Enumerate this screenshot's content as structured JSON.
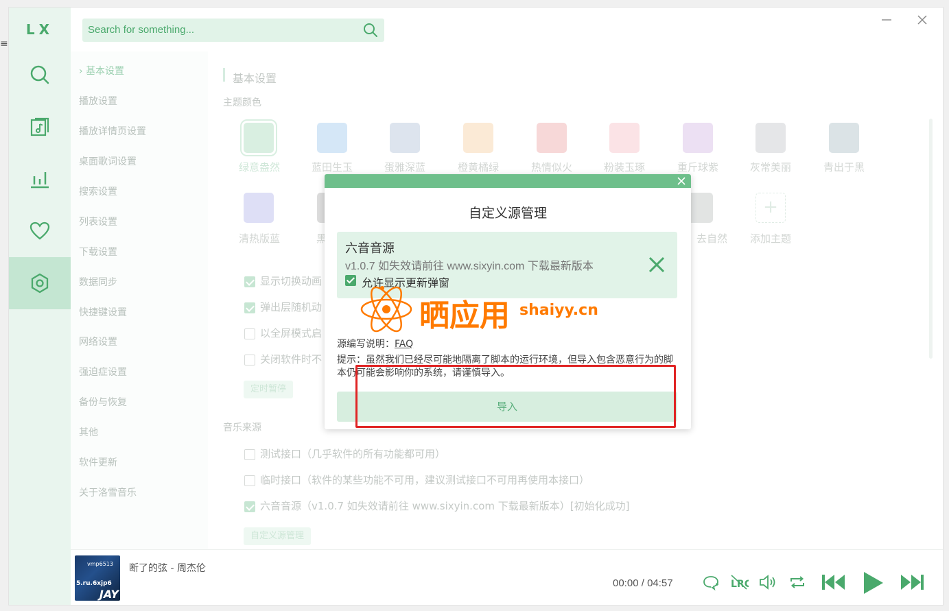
{
  "app": {
    "logo": "LX"
  },
  "colors": {
    "accent": "#4aa96c",
    "nav_bg": "#e9f5ee",
    "nav_active": "#c4e6d2",
    "modal_header": "#6ebf8b"
  },
  "outer": {
    "menu_glyph": "≡"
  },
  "nav": {
    "items": [
      {
        "icon": "search-icon"
      },
      {
        "icon": "music-list-icon"
      },
      {
        "icon": "chart-icon"
      },
      {
        "icon": "heart-icon"
      },
      {
        "icon": "settings-icon",
        "active": true
      }
    ]
  },
  "search": {
    "placeholder": "Search for something..."
  },
  "settings_nav": {
    "items": [
      "基本设置",
      "播放设置",
      "播放详情页设置",
      "桌面歌词设置",
      "搜索设置",
      "列表设置",
      "下载设置",
      "数据同步",
      "快捷键设置",
      "网络设置",
      "强迫症设置",
      "备份与恢复",
      "其他",
      "软件更新",
      "关于洛雪音乐"
    ],
    "active_index": 0
  },
  "content": {
    "section_title": "基本设置",
    "theme_label": "主题颜色",
    "themes_row1": [
      {
        "name": "绿意盎然",
        "color": "#d9efe1"
      },
      {
        "name": "蓝田生玉",
        "color": "#d5e7f7"
      },
      {
        "name": "蛋雅深蓝",
        "color": "#dde4ee"
      },
      {
        "name": "橙黄橘绿",
        "color": "#fbead6"
      },
      {
        "name": "热情似火",
        "color": "#f7d8d8"
      },
      {
        "name": "粉装玉琢",
        "color": "#fbe3e6"
      },
      {
        "name": "重斤球紫",
        "color": "#ece0f3"
      },
      {
        "name": "灰常美丽",
        "color": "#e5e6e8"
      },
      {
        "name": "青出于黑",
        "color": "#dbe3e6"
      }
    ],
    "themes_row2": [
      {
        "name": "清热版蓝",
        "color": "#dedff6"
      },
      {
        "name": "黑",
        "color": "#dcdcdc"
      },
      {
        "name": "去自然",
        "color": "#e2e4e3"
      },
      {
        "name": "添加主题",
        "color": "#ffffff"
      }
    ],
    "options": [
      {
        "label": "显示切换动画",
        "checked": true
      },
      {
        "label": "弹出层随机动",
        "checked": true
      },
      {
        "label": "以全屏模式启",
        "checked": false
      },
      {
        "label": "关闭软件时不",
        "checked": false
      }
    ],
    "timer_button": "定时暂停",
    "music_source_label": "音乐来源",
    "sources": [
      {
        "label": "测试接口（几乎软件的所有功能都可用）",
        "checked": false
      },
      {
        "label": "临时接口（软件的某些功能不可用，建议测试接口不可用再使用本接口）",
        "checked": false
      },
      {
        "label": "六音音源（v1.0.7 如失效请前往 www.sixyin.com 下载最新版本）[初始化成功]",
        "checked": true
      }
    ],
    "custom_source_button": "自定义源管理"
  },
  "player": {
    "cover_text_1": "vmp6513",
    "cover_text_2": "5.ru.6xjp6",
    "cover_text_3": "JAY",
    "song": "断了的弦 - 周杰伦",
    "time_current": "00:00",
    "time_separator": "/",
    "time_total": "04:57",
    "lrc_label": "LRC"
  },
  "modal": {
    "title": "自定义源管理",
    "source": {
      "name": "六音音源",
      "description": "v1.0.7 如失效请前往 www.sixyin.com 下载最新版本",
      "allow_update_popup": "允许显示更新弹窗",
      "allow_update_checked": true
    },
    "faq_label": "源编写说明：",
    "faq_link": "FAQ",
    "tip": "提示：虽然我们已经尽可能地隔离了脚本的运行环境，但导入包含恶意行为的脚本仍可能会影响你的系统，请谨慎导入。",
    "import_button": "导入"
  },
  "watermark": {
    "text": "晒应用",
    "domain": "shaiyy.cn"
  }
}
